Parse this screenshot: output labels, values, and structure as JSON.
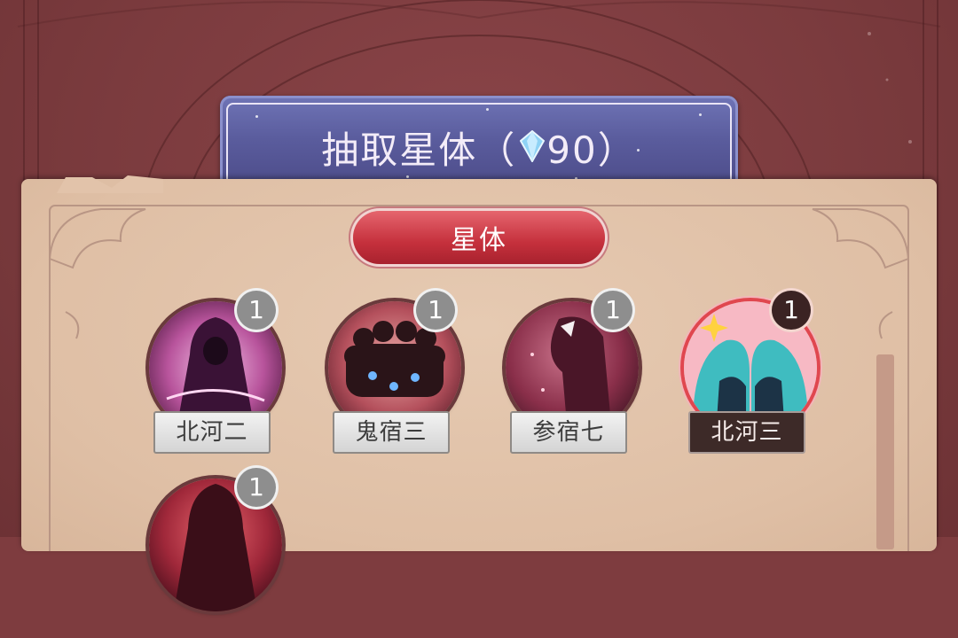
{
  "draw_banner": {
    "label": "抽取星体（",
    "cost": "90",
    "close_paren": "）",
    "currency_icon": "crystal-gem-icon"
  },
  "tabs": [
    {
      "label": "星体",
      "active": true
    }
  ],
  "items": [
    {
      "name": "北河二",
      "count": "1",
      "selected": false,
      "art": "purple-hooded-figure"
    },
    {
      "name": "鬼宿三",
      "count": "1",
      "selected": false,
      "art": "shadow-group"
    },
    {
      "name": "参宿七",
      "count": "1",
      "selected": false,
      "art": "masked-figure"
    },
    {
      "name": "北河三",
      "count": "1",
      "selected": true,
      "art": "twin-figures"
    },
    {
      "name": "",
      "count": "1",
      "selected": false,
      "art": "red-hooded-figure"
    }
  ],
  "colors": {
    "accent_red": "#c5303c",
    "banner_blue": "#5a5c9d",
    "parchment": "#e2c3aa",
    "book_red": "#7e3c3f"
  }
}
